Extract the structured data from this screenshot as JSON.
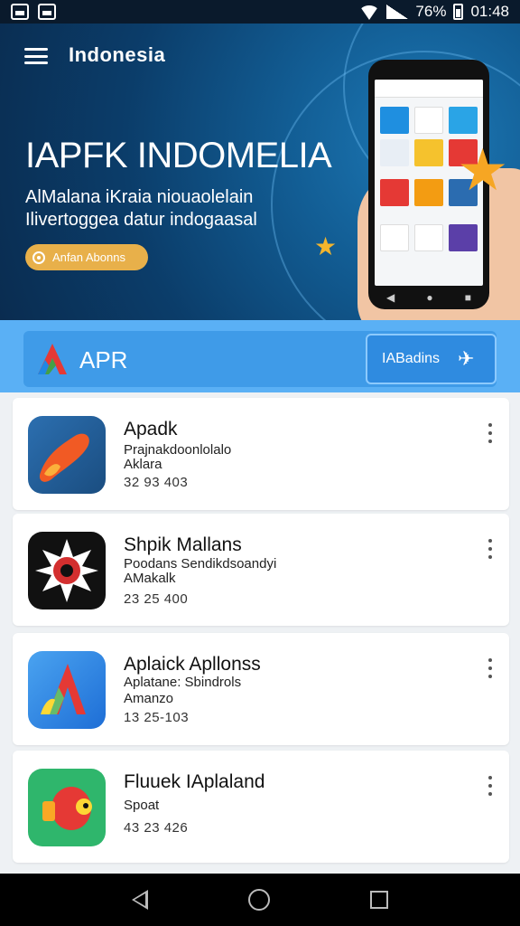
{
  "status_bar": {
    "battery": "76%",
    "time": "01:48"
  },
  "header": {
    "brand": "Indonesia"
  },
  "hero": {
    "title": "IAPFK INDOMELIA",
    "subtitle_line1": "AlMalana iKraia niouaolelain",
    "subtitle_line2": "Ilivertoggea datur indogaasal",
    "cta_label": "Anfan Abonns"
  },
  "apr_bar": {
    "label": "APR",
    "button_label": "IABadins"
  },
  "apps": [
    {
      "title": "Apadk",
      "line1": "Prajnakdoonlolalo",
      "line2": "Aklara",
      "size": "32 93 403"
    },
    {
      "title": "Shpik Mallans",
      "line1": "Poodans Sendikdsoandyi",
      "line2": "AMakalk",
      "size": "23 25 400"
    },
    {
      "title": "Aplaick Apllonss",
      "line1": "Aplatane: Sbindrols",
      "line2": "Amanzo",
      "size": "13 25-103"
    },
    {
      "title": "Fluuek IAplaland",
      "line1": "Spoat",
      "line2": "",
      "size": "43 23 426"
    }
  ]
}
